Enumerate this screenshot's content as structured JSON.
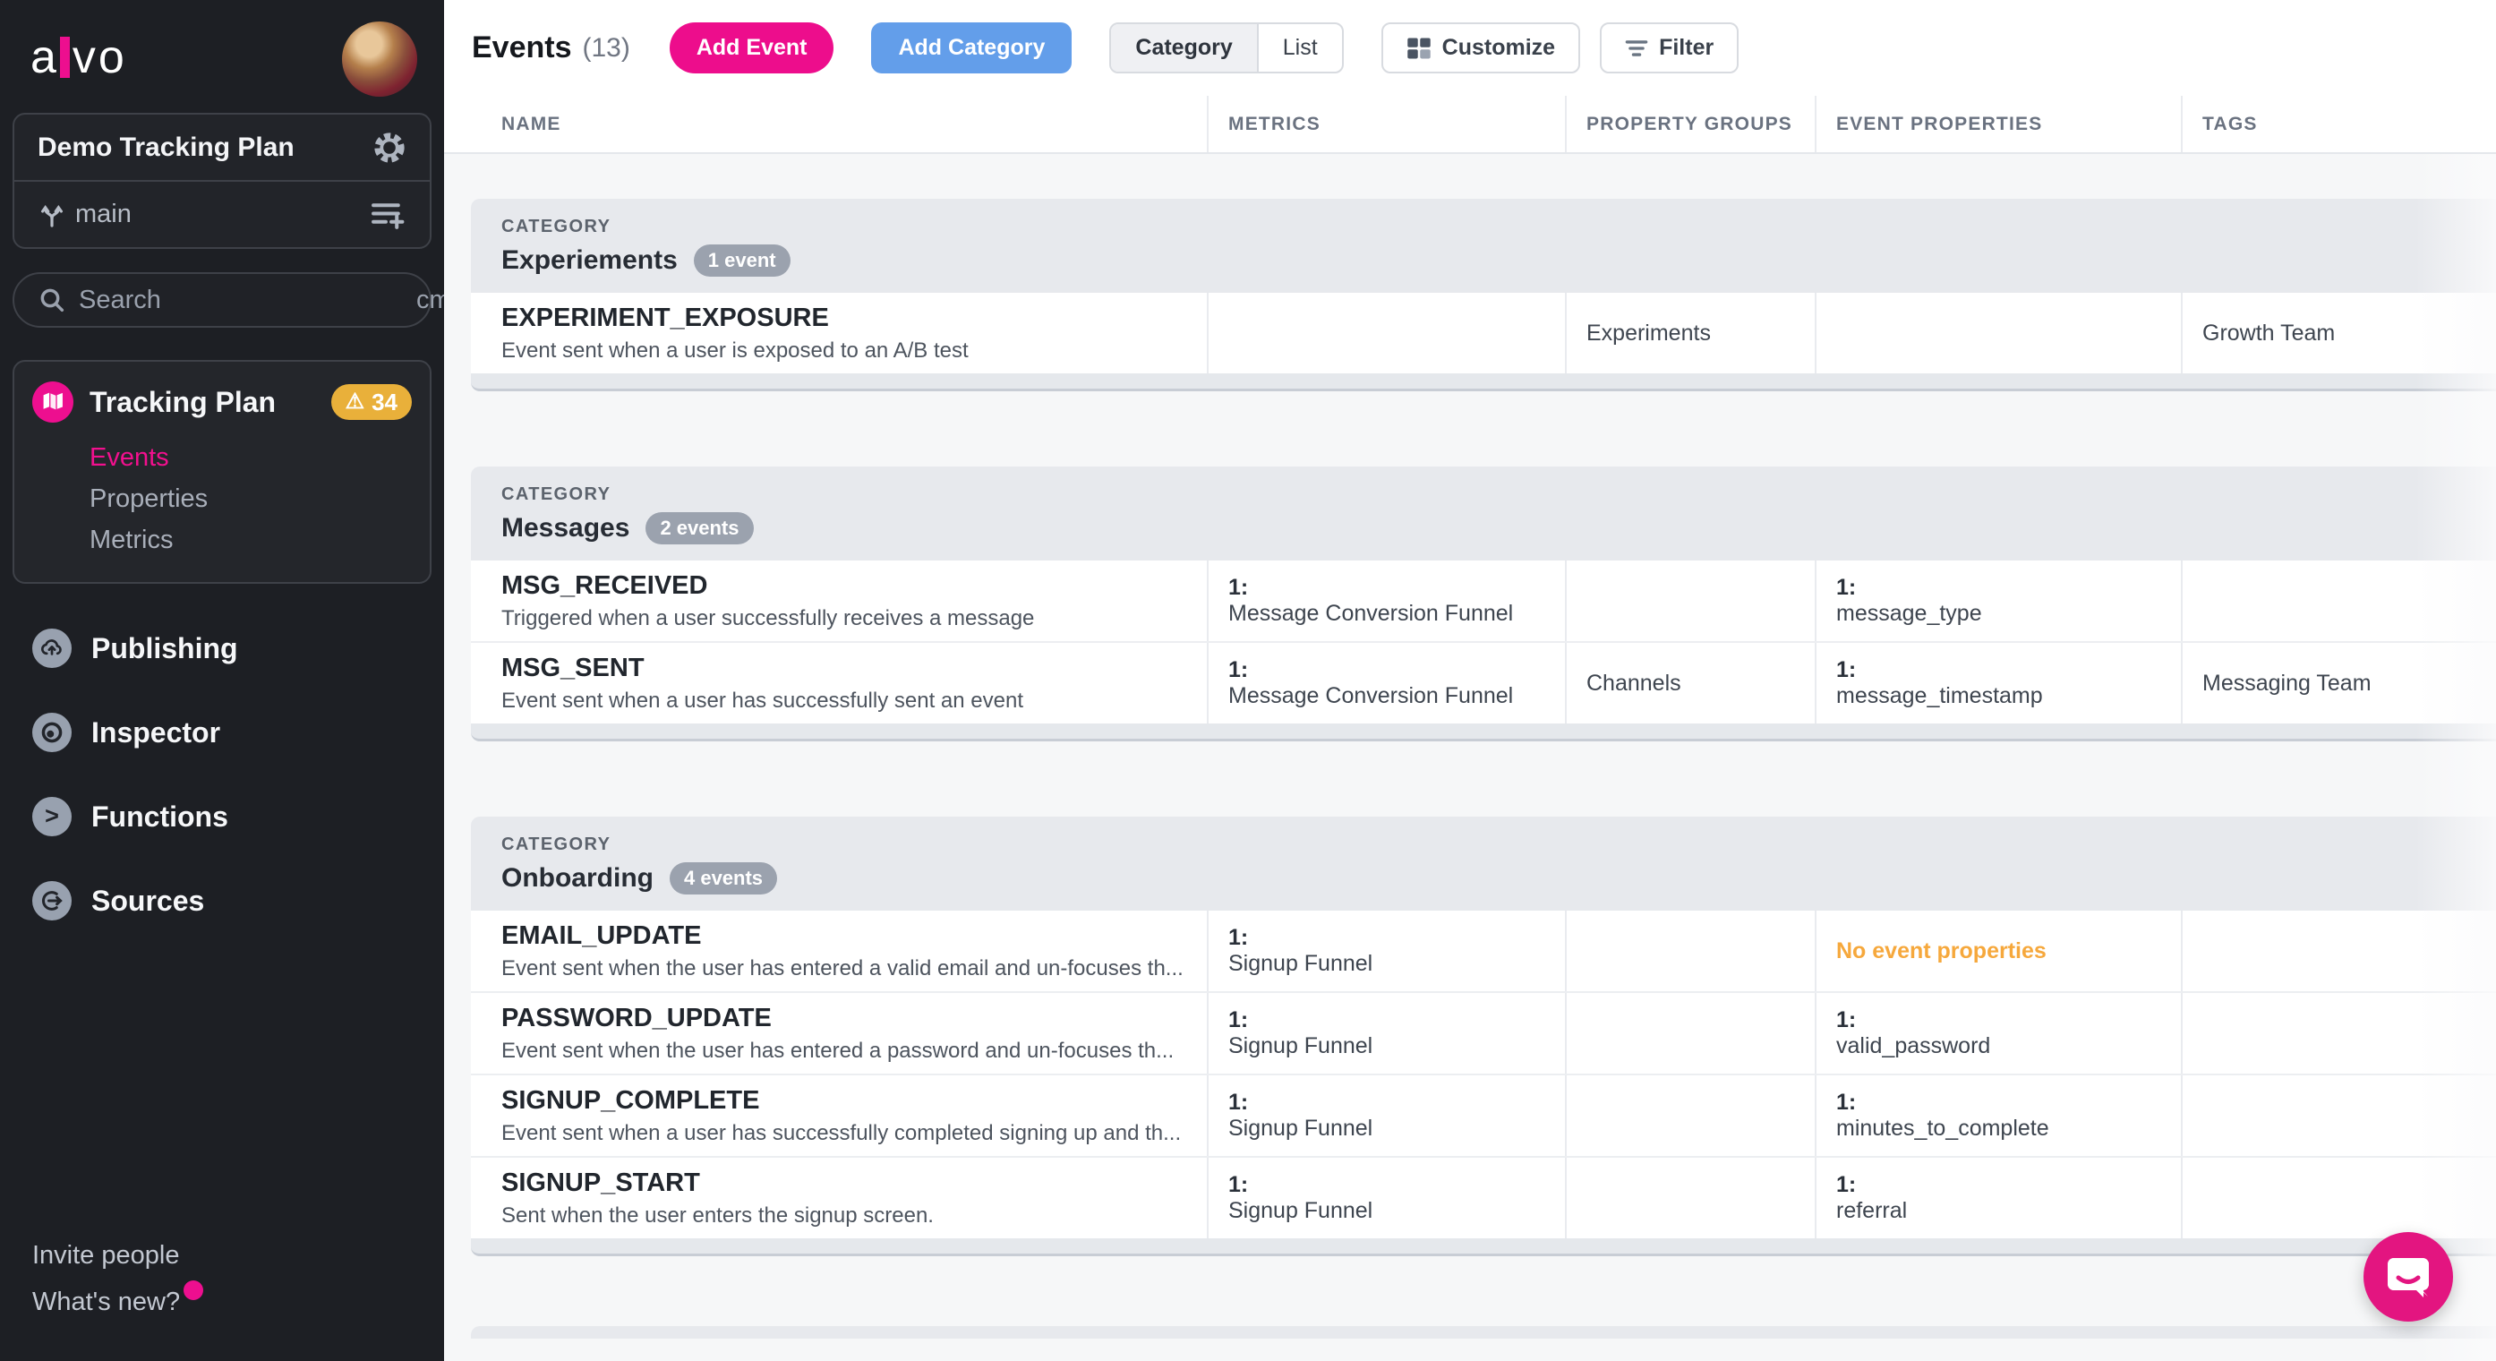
{
  "colors": {
    "accent_pink": "#ED0F8F",
    "accent_blue": "#639EEA",
    "warning_amber": "#E9B03A",
    "attention_orange": "#F6A83C",
    "intercom_pink": "#E31580",
    "sidebar_bg": "#1D1F24"
  },
  "sidebar": {
    "logo_text_left": "a",
    "logo_text_right": "vo",
    "workspace": {
      "name": "Demo Tracking Plan"
    },
    "branch": {
      "name": "main"
    },
    "search": {
      "placeholder": "Search",
      "shortcut": "cmd+f"
    },
    "tracking_plan": {
      "label": "Tracking Plan",
      "issues_count": "34",
      "sub_items": [
        {
          "label": "Events",
          "active": true
        },
        {
          "label": "Properties",
          "active": false
        },
        {
          "label": "Metrics",
          "active": false
        }
      ]
    },
    "nav_items": [
      {
        "label": "Publishing",
        "icon": "cloud-upload-icon"
      },
      {
        "label": "Inspector",
        "icon": "target-icon"
      },
      {
        "label": "Functions",
        "icon": "chevron-circle-icon"
      },
      {
        "label": "Sources",
        "icon": "source-arrow-icon"
      }
    ],
    "footer_links": [
      {
        "label": "Invite people",
        "has_notification_dot": false
      },
      {
        "label": "What's new?",
        "has_notification_dot": true
      }
    ]
  },
  "header": {
    "title": "Events",
    "count": "(13)",
    "add_event_label": "Add Event",
    "add_category_label": "Add Category",
    "view_toggle": {
      "options": [
        "Category",
        "List"
      ],
      "selected": "Category"
    },
    "customize_label": "Customize",
    "filter_label": "Filter"
  },
  "table": {
    "columns": [
      "NAME",
      "METRICS",
      "PROPERTY GROUPS",
      "EVENT PROPERTIES",
      "TAGS"
    ],
    "category_kicker": "CATEGORY",
    "categories": [
      {
        "name": "Experiements",
        "badge": "1 event",
        "events": [
          {
            "name": "EXPERIMENT_EXPOSURE",
            "description": "Event sent when a user is exposed to an A/B test",
            "metrics": null,
            "property_group": "Experiments",
            "event_properties": null,
            "event_properties_empty": null,
            "tags": "Growth Team"
          }
        ]
      },
      {
        "name": "Messages",
        "badge": "2 events",
        "events": [
          {
            "name": "MSG_RECEIVED",
            "description": "Triggered when a user successfully receives a message",
            "metrics": {
              "count": "1",
              "label": "Message Conversion Funnel"
            },
            "property_group": null,
            "event_properties": {
              "count": "1",
              "label": "message_type"
            },
            "event_properties_empty": null,
            "tags": null
          },
          {
            "name": "MSG_SENT",
            "description": "Event sent when a user has successfully sent an event",
            "metrics": {
              "count": "1",
              "label": "Message Conversion Funnel"
            },
            "property_group": "Channels",
            "event_properties": {
              "count": "1",
              "label": "message_timestamp"
            },
            "event_properties_empty": null,
            "tags": "Messaging Team"
          }
        ]
      },
      {
        "name": "Onboarding",
        "badge": "4 events",
        "events": [
          {
            "name": "EMAIL_UPDATE",
            "description": "Event sent when the user has entered a valid email and un-focuses th...",
            "metrics": {
              "count": "1",
              "label": "Signup Funnel"
            },
            "property_group": null,
            "event_properties": null,
            "event_properties_empty": "No event properties",
            "tags": null
          },
          {
            "name": "PASSWORD_UPDATE",
            "description": "Event sent when the user has entered a password and un-focuses th...",
            "metrics": {
              "count": "1",
              "label": "Signup Funnel"
            },
            "property_group": null,
            "event_properties": {
              "count": "1",
              "label": "valid_password"
            },
            "event_properties_empty": null,
            "tags": null
          },
          {
            "name": "SIGNUP_COMPLETE",
            "description": "Event sent when a user has successfully completed signing up and th...",
            "metrics": {
              "count": "1",
              "label": "Signup Funnel"
            },
            "property_group": null,
            "event_properties": {
              "count": "1",
              "label": "minutes_to_complete"
            },
            "event_properties_empty": null,
            "tags": null
          },
          {
            "name": "SIGNUP_START",
            "description": "Sent when the user enters the signup screen.",
            "metrics": {
              "count": "1",
              "label": "Signup Funnel"
            },
            "property_group": null,
            "event_properties": {
              "count": "1",
              "label": "referral"
            },
            "event_properties_empty": null,
            "tags": null
          }
        ]
      }
    ]
  }
}
